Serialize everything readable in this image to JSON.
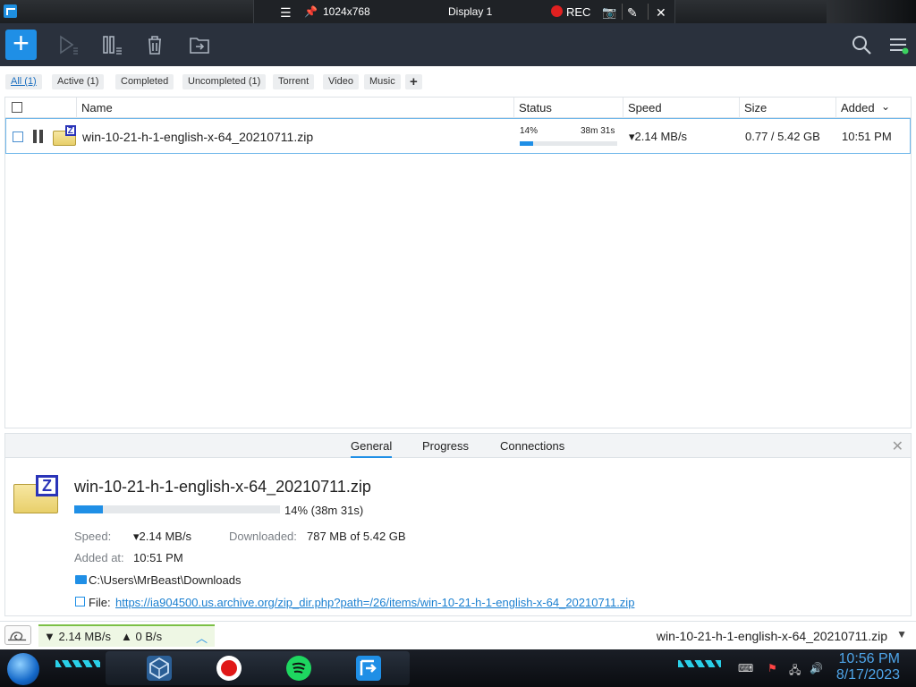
{
  "remote_bar": {
    "resolution": "1024x768",
    "display": "Display 1",
    "rec_label": "REC"
  },
  "toolbar": {
    "add_label": "+"
  },
  "filters": {
    "tabs": [
      {
        "label": "All (1)",
        "active": true
      },
      {
        "label": "Active (1)"
      },
      {
        "label": "Completed"
      },
      {
        "label": "Uncompleted (1)"
      },
      {
        "label": "Torrent"
      },
      {
        "label": "Video"
      },
      {
        "label": "Music"
      },
      {
        "label": "+"
      }
    ]
  },
  "list": {
    "columns": {
      "name": "Name",
      "status": "Status",
      "speed": "Speed",
      "size": "Size",
      "added": "Added"
    },
    "sort_indicator": "⌄",
    "rows": [
      {
        "name": "win-10-21-h-1-english-x-64_20210711.zip",
        "percent_label": "14%",
        "progress": 0.14,
        "eta": "38m 31s",
        "speed": "▾2.14 MB/s",
        "size": "0.77 / 5.42 GB",
        "added": "10:51 PM"
      }
    ]
  },
  "detail": {
    "tabs": [
      "General",
      "Progress",
      "Connections"
    ],
    "selected_tab": "General",
    "file_name": "win-10-21-h-1-english-x-64_20210711.zip",
    "progress": 0.14,
    "progress_text": "14% (38m 31s)",
    "speed_label": "Speed:",
    "speed_value": "▾2.14 MB/s",
    "downloaded_label": "Downloaded:",
    "downloaded_value": "787 MB of 5.42 GB",
    "added_label": "Added at:",
    "added_value": "10:51 PM",
    "folder": "C:\\Users\\MrBeast\\Downloads",
    "file_label": "File:",
    "url": "https://ia904500.us.archive.org/zip_dir.php?path=/26/items/win-10-21-h-1-english-x-64_20210711.zip"
  },
  "statusbar": {
    "down_speed": "▼ 2.14 MB/s",
    "up_speed": "▲ 0 B/s",
    "file_name": "win-10-21-h-1-english-x-64_20210711.zip"
  },
  "taskbar": {
    "time": "10:56 PM",
    "date": "8/17/2023"
  },
  "colors": {
    "accent": "#1f8fe6",
    "toolbar_bg": "#2a313d"
  }
}
